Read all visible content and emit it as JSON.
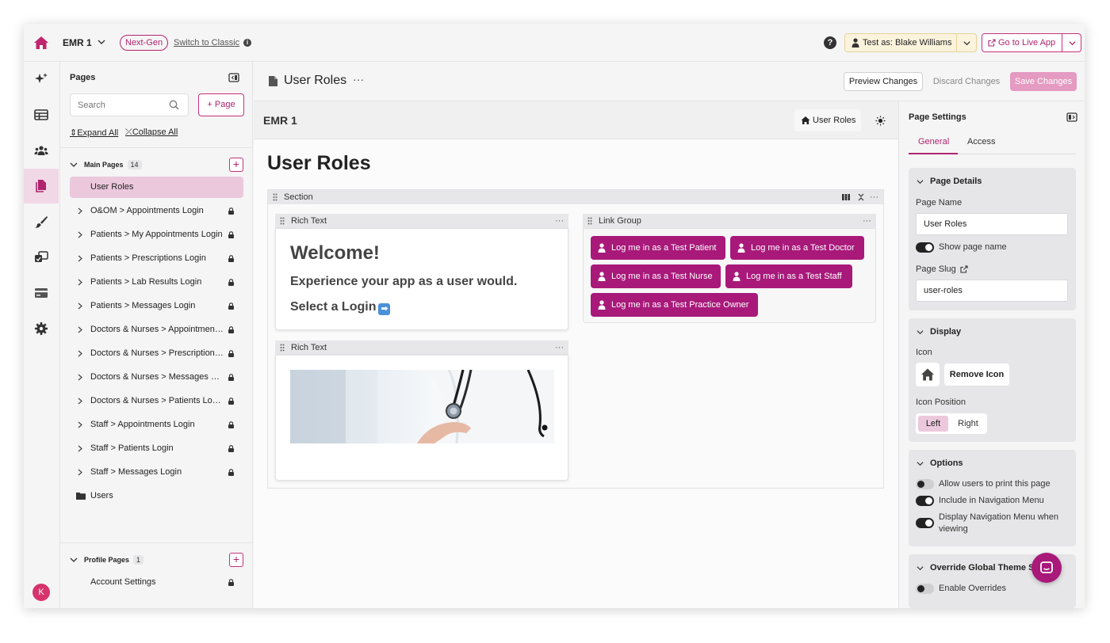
{
  "topbar": {
    "app_name": "EMR 1",
    "next_gen_badge": "Next-Gen",
    "switch_classic": "Switch to Classic",
    "test_as": "Test as: Blake Williams",
    "go_live": "Go to Live App"
  },
  "pages_panel": {
    "title": "Pages",
    "search_placeholder": "Search",
    "add_page": "+ Page",
    "expand_all": "Expand All",
    "collapse_all": "Collapse All",
    "main_group": {
      "label": "Main Pages",
      "count": "14"
    },
    "main_items": [
      {
        "label": "User Roles"
      },
      {
        "label": "O&OM > Appointments Login"
      },
      {
        "label": "Patients > My Appointments Login"
      },
      {
        "label": "Patients > Prescriptions Login"
      },
      {
        "label": "Patients > Lab Results Login"
      },
      {
        "label": "Patients > Messages Login"
      },
      {
        "label": "Doctors & Nurses > Appointments Login"
      },
      {
        "label": "Doctors & Nurses > Prescriptions Login"
      },
      {
        "label": "Doctors & Nurses > Messages Login"
      },
      {
        "label": "Doctors & Nurses > Patients Login"
      },
      {
        "label": "Staff > Appointments Login"
      },
      {
        "label": "Staff > Patients Login"
      },
      {
        "label": "Staff > Messages Login"
      }
    ],
    "folder_item": "Users",
    "profile_group": {
      "label": "Profile Pages",
      "count": "1"
    },
    "profile_items": [
      {
        "label": "Account Settings"
      }
    ]
  },
  "editor": {
    "page_title": "User Roles",
    "more": "···",
    "preview": "Preview Changes",
    "discard": "Discard Changes",
    "save": "Save Changes"
  },
  "canvas": {
    "app_name": "EMR 1",
    "nav_item": "User Roles",
    "heading": "User Roles",
    "section_label": "Section",
    "rich_text_label": "Rich Text",
    "rich_text_label_2": "Rich Text",
    "link_group_label": "Link Group",
    "welcome": "Welcome!",
    "experience": "Experience your app as a user would.",
    "select_login": "Select a Login",
    "select_arrow": "➡",
    "dots": "···",
    "login_buttons": [
      "Log me in as a Test Patient",
      "Log me in as a Test Doctor",
      "Log me in as a Test Nurse",
      "Log me in as a Test Staff",
      "Log me in as a Test Practice Owner"
    ]
  },
  "settings": {
    "title": "Page Settings",
    "tabs": [
      "General",
      "Access"
    ],
    "page_details": {
      "heading": "Page Details",
      "page_name_label": "Page Name",
      "page_name_value": "User Roles",
      "show_page_name": "Show page name",
      "slug_label": "Page Slug",
      "slug_value": "user-roles"
    },
    "display": {
      "heading": "Display",
      "icon_label": "Icon",
      "remove_icon": "Remove Icon",
      "icon_position_label": "Icon Position",
      "pos_left": "Left",
      "pos_right": "Right"
    },
    "options": {
      "heading": "Options",
      "allow_print": "Allow users to print this page",
      "include_nav": "Include in Navigation Menu",
      "display_nav": "Display Navigation Menu when viewing"
    },
    "override": {
      "heading": "Override Global Theme St",
      "enable_overrides": "Enable Overrides"
    }
  },
  "avatar_letter": "K",
  "colors": {
    "accent": "#a8197a",
    "accent_light": "#ecc8dd",
    "save_disabled": "#e49ac1"
  }
}
